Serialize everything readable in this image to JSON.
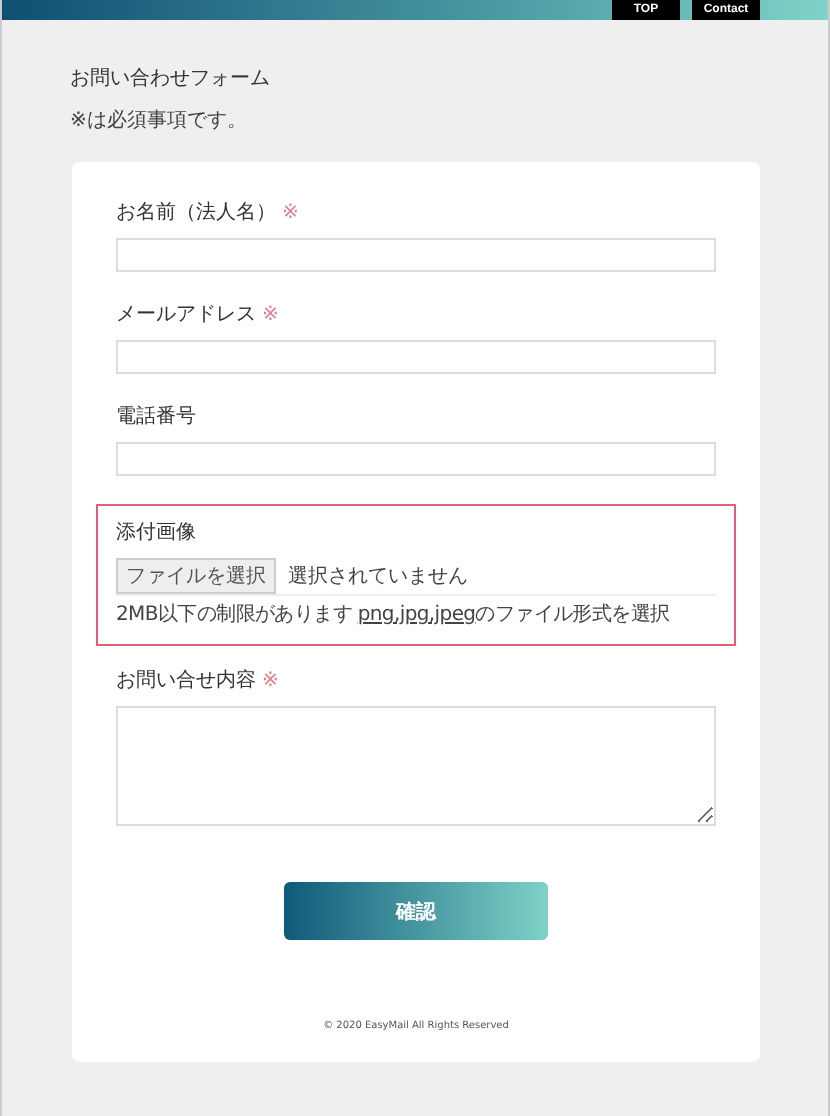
{
  "nav": [
    {
      "label": "TOP"
    },
    {
      "label": "Contact"
    }
  ],
  "title": "お問い合わせフォーム",
  "required_note": "※は必須事項です。",
  "fields": [
    {
      "kind": "text",
      "label": "お名前（法人名）",
      "required_mark": "※",
      "highlighted": false
    },
    {
      "kind": "text",
      "label": "メールアドレス",
      "required_mark": "※",
      "highlighted": false
    },
    {
      "kind": "text",
      "label": "電話番号",
      "highlighted": false
    },
    {
      "kind": "file",
      "label": "添付画像",
      "highlighted": true,
      "file_button": "ファイルを選択",
      "file_status": "選択されていません",
      "note_before": "2MB以下の制限があります ",
      "note_link": "png,jpg,jpeg",
      "note_after": "のファイル形式を選択"
    },
    {
      "kind": "textarea",
      "label": "お問い合せ内容",
      "required_mark": "※",
      "highlighted": false
    }
  ],
  "submit": "確認",
  "copyright": "© 2020 EasyMail All Rights Reserved"
}
